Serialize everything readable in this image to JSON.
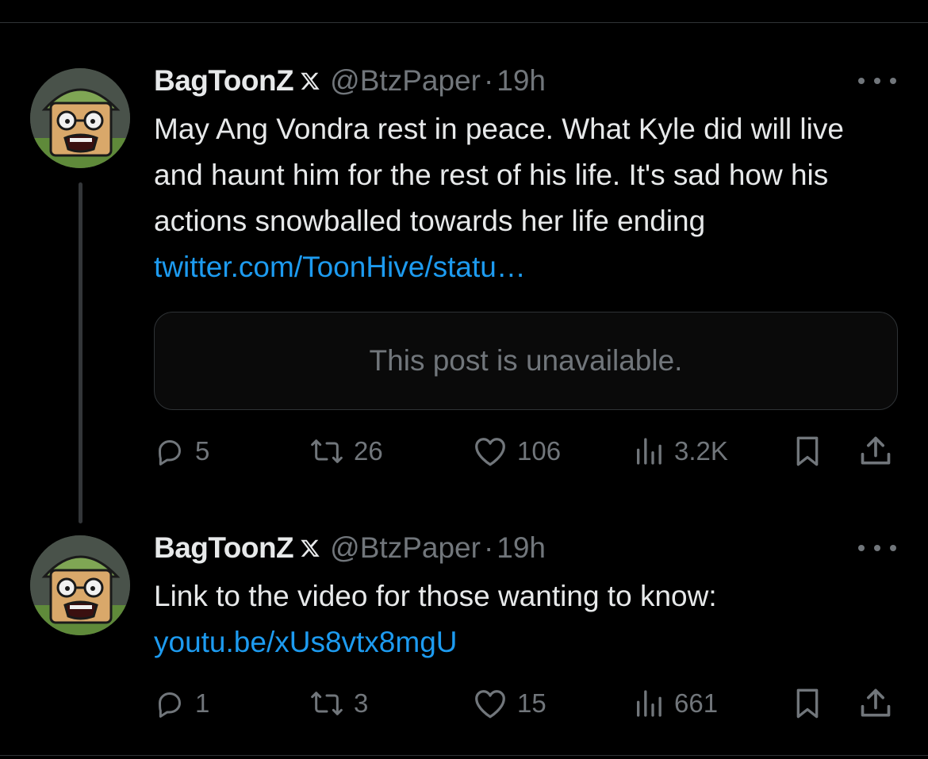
{
  "colors": {
    "background": "#000000",
    "text": "#e7e9ea",
    "muted": "#71767b",
    "link": "#1d9bf0",
    "border": "#2f3336"
  },
  "posts": [
    {
      "display_name": "BagToonZ",
      "badge_icon": "x-logo-icon",
      "handle": "@BtzPaper",
      "separator": "·",
      "time": "19h",
      "text": "May Ang Vondra rest in peace. What Kyle did will live and haunt him for the rest of his life. It's sad how his actions snowballed towards her life ending ",
      "link": "twitter.com/ToonHive/statu…",
      "quote_unavailable": "This post is unavailable.",
      "actions": {
        "replies": "5",
        "reposts": "26",
        "likes": "106",
        "views": "3.2K"
      }
    },
    {
      "display_name": "BagToonZ",
      "badge_icon": "x-logo-icon",
      "handle": "@BtzPaper",
      "separator": "·",
      "time": "19h",
      "text": "Link to the video for those wanting to know: ",
      "link": "youtu.be/xUs8vtx8mgU",
      "actions": {
        "replies": "1",
        "reposts": "3",
        "likes": "15",
        "views": "661"
      }
    }
  ]
}
